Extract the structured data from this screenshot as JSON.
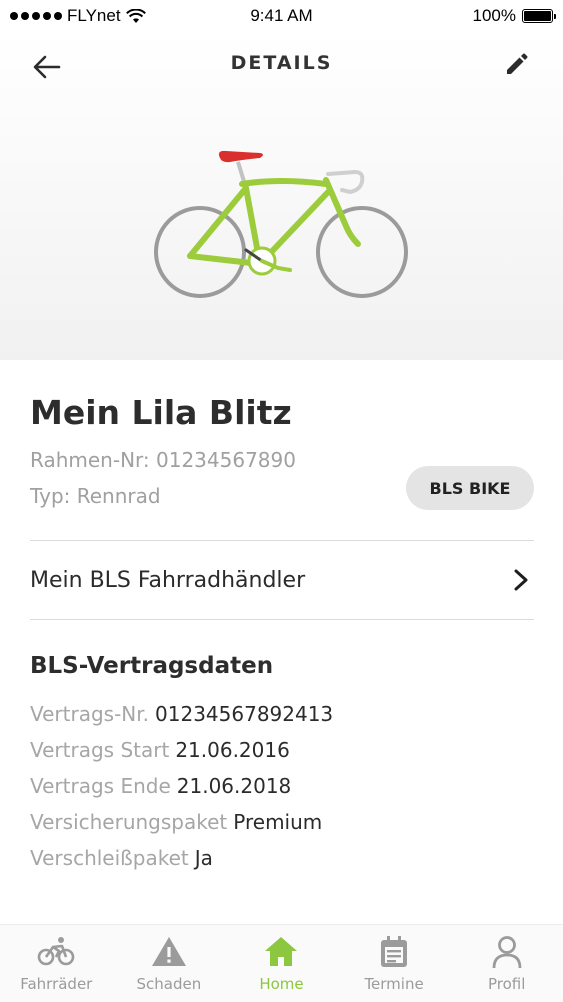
{
  "status_bar": {
    "carrier": "FLYnet",
    "time": "9:41 AM",
    "battery": "100%",
    "battery_level": 1.0
  },
  "header": {
    "title": "DETAILS",
    "back_icon": "arrow-left-icon",
    "edit_icon": "pencil-icon"
  },
  "bike": {
    "name": "Mein Lila Blitz",
    "frame_number": "Rahmen-Nr: 01234567890",
    "type": "Typ: Rennrad",
    "brand_chip": "BLS BIKE",
    "colors": {
      "frame": "#9ccc3b",
      "saddle": "#d9302e",
      "wheels": "#9b9b9b",
      "bars": "#cfcfcf"
    }
  },
  "dealer": {
    "label": "Mein BLS Fahrradhändler",
    "icon": "chevron-right-icon"
  },
  "contract": {
    "title": "BLS-Vertragsdaten",
    "rows": [
      {
        "key": "Vertrags-Nr.",
        "value": "01234567892413"
      },
      {
        "key": "Vertrags Start",
        "value": "21.06.2016"
      },
      {
        "key": "Vertrags Ende",
        "value": "21.06.2018"
      },
      {
        "key": "Versicherungspaket",
        "value": "Premium"
      },
      {
        "key": "Verschleißpaket",
        "value": "Ja"
      }
    ]
  },
  "tabs": [
    {
      "label": "Fahrräder",
      "icon": "bicycle-icon",
      "active": false
    },
    {
      "label": "Schaden",
      "icon": "warning-icon",
      "active": false
    },
    {
      "label": "Home",
      "icon": "home-icon",
      "active": true
    },
    {
      "label": "Termine",
      "icon": "calendar-icon",
      "active": false
    },
    {
      "label": "Profil",
      "icon": "user-icon",
      "active": false
    }
  ],
  "accent_color": "#8dc63f"
}
